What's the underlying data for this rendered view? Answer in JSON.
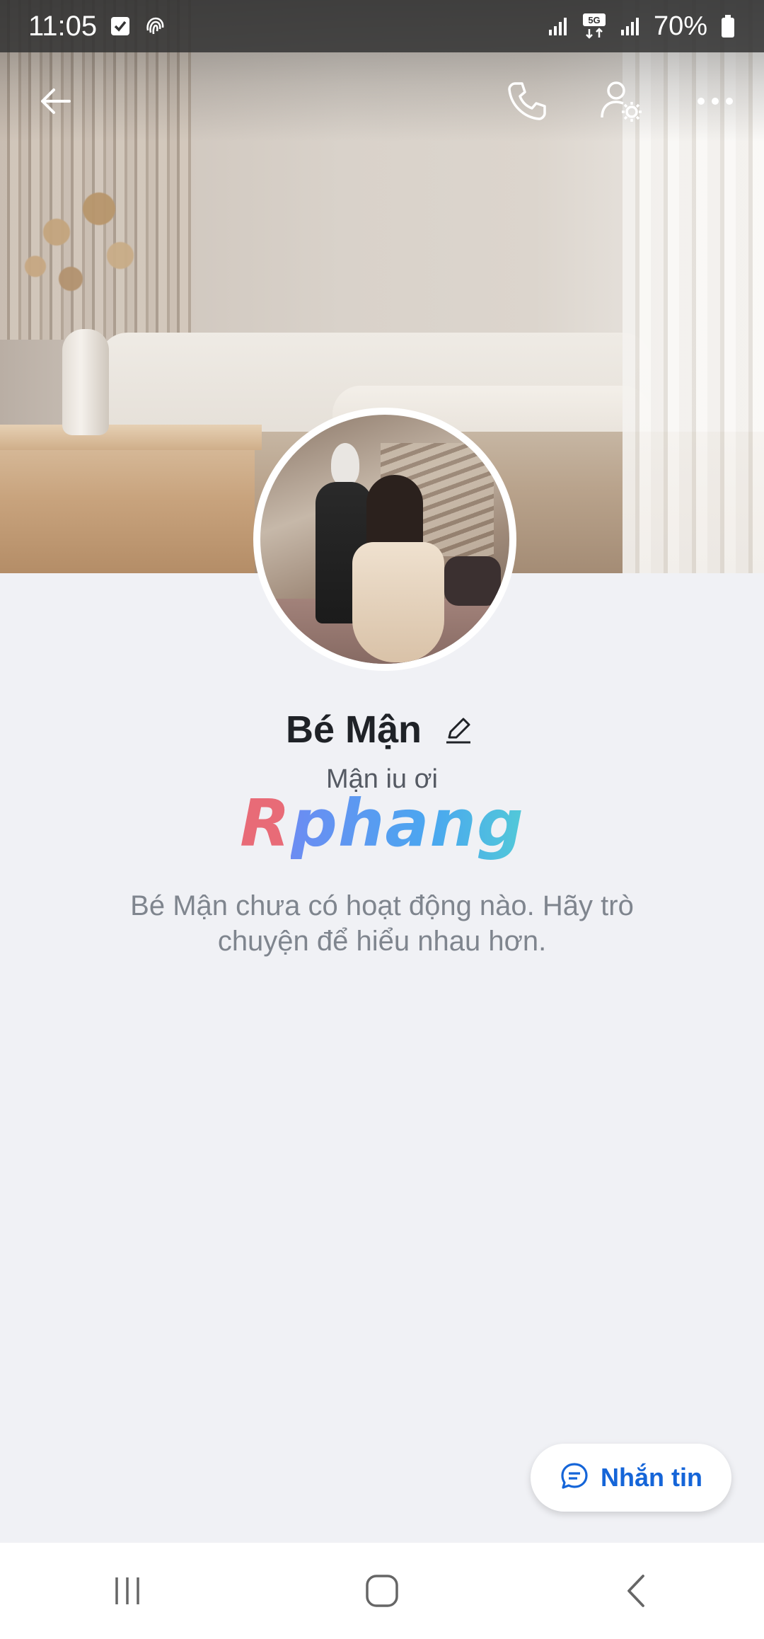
{
  "status_bar": {
    "time": "11:05",
    "battery": "70%",
    "network": "5G",
    "icons": [
      "checkbox-notification-icon",
      "fingerprint-icon",
      "signal-icon",
      "5g-icon",
      "signal-icon",
      "battery-icon"
    ]
  },
  "toolbar": {
    "back_icon": "back-arrow-icon",
    "call_icon": "phone-icon",
    "settings_icon": "user-settings-icon",
    "more_icon": "more-icon"
  },
  "profile": {
    "name": "Bé Mận",
    "bio": "Mận iu ơi",
    "empty_activity": "Bé Mận chưa có hoạt động nào. Hãy trò chuyện để hiểu nhau hơn."
  },
  "watermark": {
    "part1": "R",
    "part2": "phang"
  },
  "message_button": {
    "label": "Nhắn tin",
    "icon": "chat-bubble-icon"
  },
  "nav": {
    "items": [
      "recent-apps-icon",
      "home-icon",
      "back-icon"
    ]
  },
  "colors": {
    "accent": "#1565d8",
    "background": "#f0f1f5",
    "name_text": "#1f2227",
    "muted_text": "#7f858e"
  }
}
